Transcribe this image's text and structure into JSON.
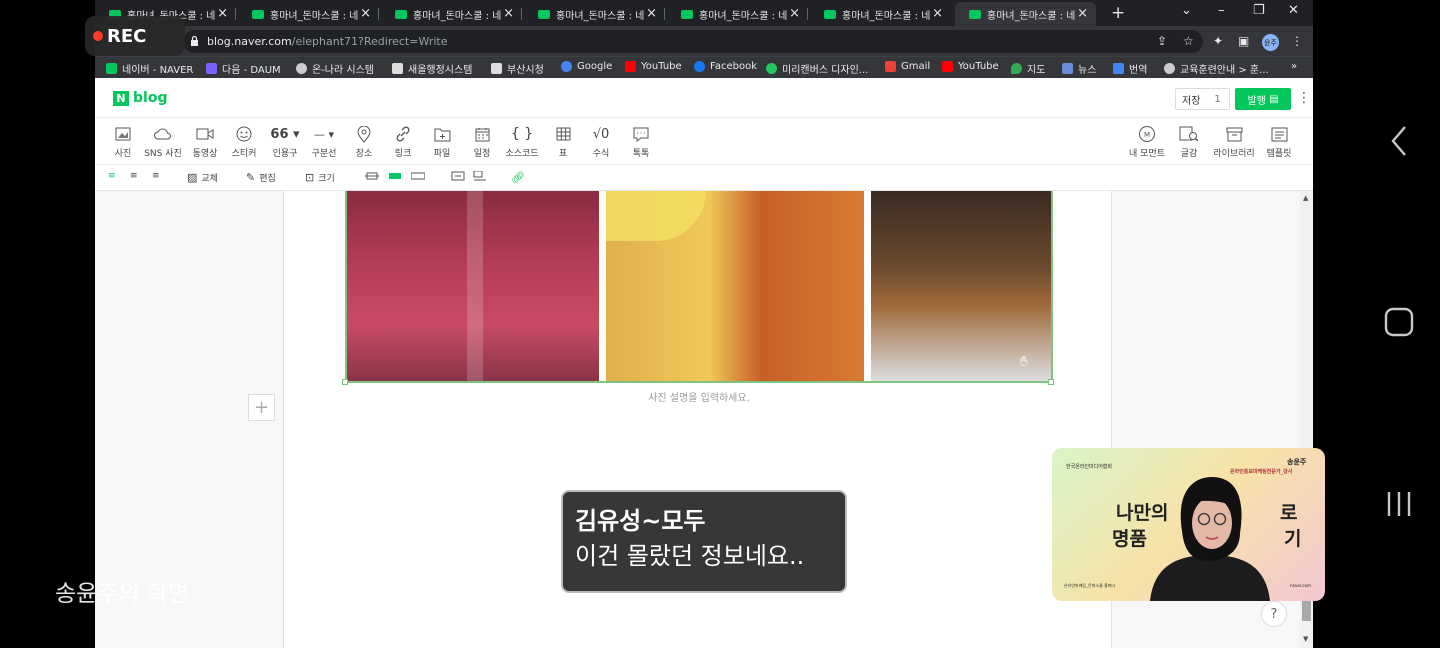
{
  "tabs": [
    {
      "title": "홍마녀_돈마스쿨 : 네"
    },
    {
      "title": "홍마녀_돈마스쿨 : 네"
    },
    {
      "title": "홍마녀_돈마스쿨 : 네"
    },
    {
      "title": "홍마녀_돈마스쿨 : 네"
    },
    {
      "title": "홍마녀_돈마스쿨 : 네"
    },
    {
      "title": "홍마녀_돈마스쿨 : 네"
    },
    {
      "title": "홍마녀_돈마스쿨 : 네"
    }
  ],
  "address": {
    "host": "blog.naver.com",
    "path": "/elephant71?Redirect=Write"
  },
  "rec_label": "REC",
  "profile_initials": "윤주",
  "bookmarks": [
    {
      "label": "네이버 - NAVER",
      "color": "#03c75a"
    },
    {
      "label": "다음 - DAUM",
      "color": "#7b61ff"
    },
    {
      "label": "온-나라 시스템",
      "color": "#cccccc"
    },
    {
      "label": "새올행정시스템",
      "color": "#dddddd"
    },
    {
      "label": "부산시청",
      "color": "#dddddd"
    },
    {
      "label": "Google",
      "color": "#4285f4"
    },
    {
      "label": "YouTube",
      "color": "#ff0000"
    },
    {
      "label": "Facebook",
      "color": "#1877f2"
    },
    {
      "label": "미리캔버스 디자인...",
      "color": "#22c55e"
    },
    {
      "label": "Gmail",
      "color": "#ea4335"
    },
    {
      "label": "YouTube",
      "color": "#ff0000"
    },
    {
      "label": "지도",
      "color": "#34a853"
    },
    {
      "label": "뉴스",
      "color": "#6b8bd6"
    },
    {
      "label": "번역",
      "color": "#4285f4"
    },
    {
      "label": "교육훈련안내 > 훈...",
      "color": "#cccccc"
    }
  ],
  "blog": {
    "logo_letter": "N",
    "logo_text": "blog",
    "save_label": "저장",
    "save_count": "1",
    "publish_label": "발행"
  },
  "toolbar": [
    {
      "label": "사진",
      "icon": "photo-icon"
    },
    {
      "label": "SNS 사진",
      "icon": "cloud-icon"
    },
    {
      "label": "동영상",
      "icon": "video-icon"
    },
    {
      "label": "스티커",
      "icon": "sticker-icon"
    },
    {
      "label": "인용구",
      "icon": "quote-icon"
    },
    {
      "label": "구분선",
      "icon": "divider-icon"
    },
    {
      "label": "장소",
      "icon": "location-icon"
    },
    {
      "label": "링크",
      "icon": "link-icon"
    },
    {
      "label": "파일",
      "icon": "file-icon"
    },
    {
      "label": "일정",
      "icon": "calendar-icon"
    },
    {
      "label": "소스코드",
      "icon": "code-icon"
    },
    {
      "label": "표",
      "icon": "table-icon"
    },
    {
      "label": "수식",
      "icon": "formula-icon"
    },
    {
      "label": "톡톡",
      "icon": "talk-icon"
    }
  ],
  "toolbar_right": [
    {
      "label": "내 모먼트",
      "icon": "moment-icon"
    },
    {
      "label": "글감",
      "icon": "material-icon"
    },
    {
      "label": "라이브러리",
      "icon": "library-icon"
    },
    {
      "label": "템플릿",
      "icon": "template-icon"
    }
  ],
  "subbar": {
    "replace_label": "교체",
    "edit_label": "편집",
    "size_label": "크기"
  },
  "editor": {
    "caption_placeholder": "사진 설명을 입력하세요.",
    "help_label": "?"
  },
  "chat": {
    "name": "김유성~모두",
    "message": "이건 몰랐던 정보네요.."
  },
  "video": {
    "org": "한국온라인미디어협회",
    "presenter": "송윤주",
    "role": "온라인홍보마케팅전문가_강사",
    "headline1": "나만의",
    "headline1b": "로",
    "headline2": "명품",
    "headline2b": "기",
    "footer_left": "온라인마케팅_돈마스쿨 홍마녀",
    "footer_right": "naver.com"
  },
  "screen_owner": "송윤주의 화면"
}
